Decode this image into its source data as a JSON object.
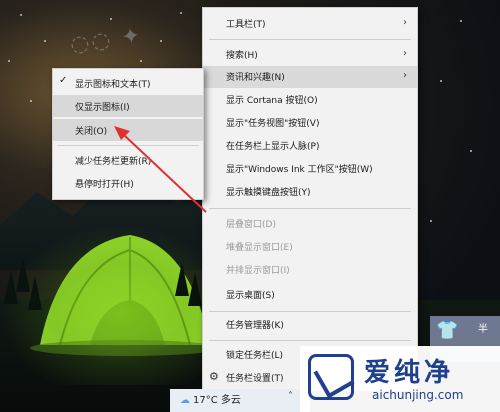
{
  "context_menu": {
    "items": [
      {
        "label": "工具栏(T)",
        "submenu": true
      },
      {
        "label": "搜索(H)",
        "submenu": true
      },
      {
        "label": "资讯和兴趣(N)",
        "submenu": true
      },
      {
        "label": "显示 Cortana 按钮(O)"
      },
      {
        "label": "显示\"任务视图\"按钮(V)"
      },
      {
        "label": "在任务栏上显示人脉(P)"
      },
      {
        "label": "显示\"Windows Ink 工作区\"按钮(W)"
      },
      {
        "label": "显示触摸键盘按钮(Y)"
      },
      {
        "label": "层叠窗口(D)",
        "disabled": true
      },
      {
        "label": "堆叠显示窗口(E)",
        "disabled": true
      },
      {
        "label": "并排显示窗口(I)",
        "disabled": true
      },
      {
        "label": "显示桌面(S)"
      },
      {
        "label": "任务管理器(K)"
      },
      {
        "label": "锁定任务栏(L)"
      },
      {
        "label": "任务栏设置(T)",
        "icon": "gear-icon"
      }
    ]
  },
  "submenu": {
    "items": [
      {
        "label": "显示图标和文本(T)",
        "checked": true
      },
      {
        "label": "仅显示图标(I)"
      },
      {
        "label": "关闭(O)"
      },
      {
        "label": "减少任务栏更新(R)"
      },
      {
        "label": "悬停时打开(H)"
      }
    ]
  },
  "taskbar": {
    "weather_text": "17°C 多云",
    "weather_icon": "cloud-icon",
    "tray_up_icon": "chevron-up-icon"
  },
  "corner_widget": {
    "icon": "shirt-icon",
    "text": "半"
  },
  "brand": {
    "name": "爱纯净",
    "url": "aichunjing.com",
    "color": "#1f3f8f"
  },
  "annotation_color": "#e03030"
}
